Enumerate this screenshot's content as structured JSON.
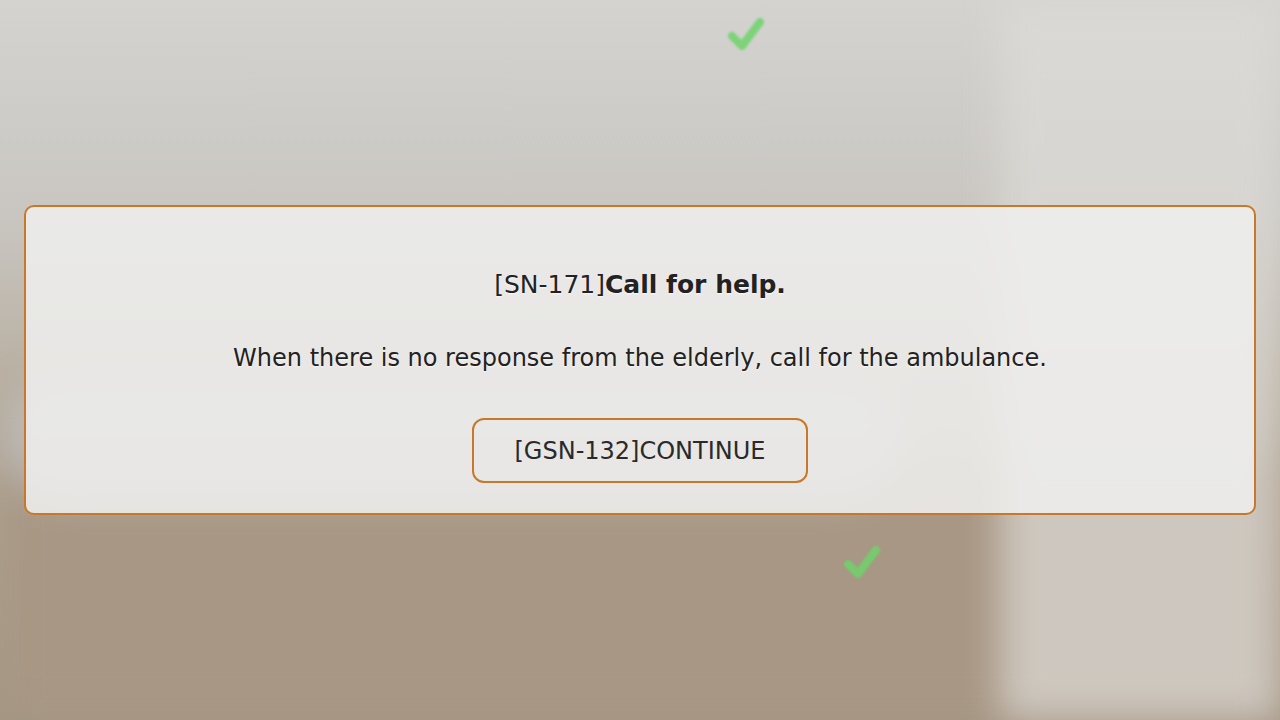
{
  "dialog": {
    "title_code": "[SN-171]",
    "title": "Call for help.",
    "message": "When there is no response from the elderly, call for the ambulance.",
    "button": "[GSN-132]CONTINUE"
  }
}
